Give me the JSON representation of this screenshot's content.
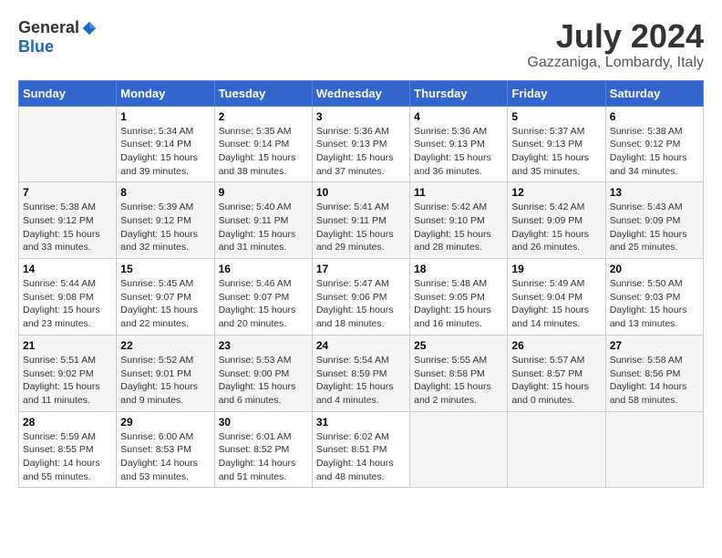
{
  "logo": {
    "general": "General",
    "blue": "Blue"
  },
  "title": "July 2024",
  "location": "Gazzaniga, Lombardy, Italy",
  "days_of_week": [
    "Sunday",
    "Monday",
    "Tuesday",
    "Wednesday",
    "Thursday",
    "Friday",
    "Saturday"
  ],
  "weeks": [
    [
      {
        "day": "",
        "info": ""
      },
      {
        "day": "1",
        "info": "Sunrise: 5:34 AM\nSunset: 9:14 PM\nDaylight: 15 hours\nand 39 minutes."
      },
      {
        "day": "2",
        "info": "Sunrise: 5:35 AM\nSunset: 9:14 PM\nDaylight: 15 hours\nand 38 minutes."
      },
      {
        "day": "3",
        "info": "Sunrise: 5:36 AM\nSunset: 9:13 PM\nDaylight: 15 hours\nand 37 minutes."
      },
      {
        "day": "4",
        "info": "Sunrise: 5:36 AM\nSunset: 9:13 PM\nDaylight: 15 hours\nand 36 minutes."
      },
      {
        "day": "5",
        "info": "Sunrise: 5:37 AM\nSunset: 9:13 PM\nDaylight: 15 hours\nand 35 minutes."
      },
      {
        "day": "6",
        "info": "Sunrise: 5:38 AM\nSunset: 9:12 PM\nDaylight: 15 hours\nand 34 minutes."
      }
    ],
    [
      {
        "day": "7",
        "info": "Sunrise: 5:38 AM\nSunset: 9:12 PM\nDaylight: 15 hours\nand 33 minutes."
      },
      {
        "day": "8",
        "info": "Sunrise: 5:39 AM\nSunset: 9:12 PM\nDaylight: 15 hours\nand 32 minutes."
      },
      {
        "day": "9",
        "info": "Sunrise: 5:40 AM\nSunset: 9:11 PM\nDaylight: 15 hours\nand 31 minutes."
      },
      {
        "day": "10",
        "info": "Sunrise: 5:41 AM\nSunset: 9:11 PM\nDaylight: 15 hours\nand 29 minutes."
      },
      {
        "day": "11",
        "info": "Sunrise: 5:42 AM\nSunset: 9:10 PM\nDaylight: 15 hours\nand 28 minutes."
      },
      {
        "day": "12",
        "info": "Sunrise: 5:42 AM\nSunset: 9:09 PM\nDaylight: 15 hours\nand 26 minutes."
      },
      {
        "day": "13",
        "info": "Sunrise: 5:43 AM\nSunset: 9:09 PM\nDaylight: 15 hours\nand 25 minutes."
      }
    ],
    [
      {
        "day": "14",
        "info": "Sunrise: 5:44 AM\nSunset: 9:08 PM\nDaylight: 15 hours\nand 23 minutes."
      },
      {
        "day": "15",
        "info": "Sunrise: 5:45 AM\nSunset: 9:07 PM\nDaylight: 15 hours\nand 22 minutes."
      },
      {
        "day": "16",
        "info": "Sunrise: 5:46 AM\nSunset: 9:07 PM\nDaylight: 15 hours\nand 20 minutes."
      },
      {
        "day": "17",
        "info": "Sunrise: 5:47 AM\nSunset: 9:06 PM\nDaylight: 15 hours\nand 18 minutes."
      },
      {
        "day": "18",
        "info": "Sunrise: 5:48 AM\nSunset: 9:05 PM\nDaylight: 15 hours\nand 16 minutes."
      },
      {
        "day": "19",
        "info": "Sunrise: 5:49 AM\nSunset: 9:04 PM\nDaylight: 15 hours\nand 14 minutes."
      },
      {
        "day": "20",
        "info": "Sunrise: 5:50 AM\nSunset: 9:03 PM\nDaylight: 15 hours\nand 13 minutes."
      }
    ],
    [
      {
        "day": "21",
        "info": "Sunrise: 5:51 AM\nSunset: 9:02 PM\nDaylight: 15 hours\nand 11 minutes."
      },
      {
        "day": "22",
        "info": "Sunrise: 5:52 AM\nSunset: 9:01 PM\nDaylight: 15 hours\nand 9 minutes."
      },
      {
        "day": "23",
        "info": "Sunrise: 5:53 AM\nSunset: 9:00 PM\nDaylight: 15 hours\nand 6 minutes."
      },
      {
        "day": "24",
        "info": "Sunrise: 5:54 AM\nSunset: 8:59 PM\nDaylight: 15 hours\nand 4 minutes."
      },
      {
        "day": "25",
        "info": "Sunrise: 5:55 AM\nSunset: 8:58 PM\nDaylight: 15 hours\nand 2 minutes."
      },
      {
        "day": "26",
        "info": "Sunrise: 5:57 AM\nSunset: 8:57 PM\nDaylight: 15 hours\nand 0 minutes."
      },
      {
        "day": "27",
        "info": "Sunrise: 5:58 AM\nSunset: 8:56 PM\nDaylight: 14 hours\nand 58 minutes."
      }
    ],
    [
      {
        "day": "28",
        "info": "Sunrise: 5:59 AM\nSunset: 8:55 PM\nDaylight: 14 hours\nand 55 minutes."
      },
      {
        "day": "29",
        "info": "Sunrise: 6:00 AM\nSunset: 8:53 PM\nDaylight: 14 hours\nand 53 minutes."
      },
      {
        "day": "30",
        "info": "Sunrise: 6:01 AM\nSunset: 8:52 PM\nDaylight: 14 hours\nand 51 minutes."
      },
      {
        "day": "31",
        "info": "Sunrise: 6:02 AM\nSunset: 8:51 PM\nDaylight: 14 hours\nand 48 minutes."
      },
      {
        "day": "",
        "info": ""
      },
      {
        "day": "",
        "info": ""
      },
      {
        "day": "",
        "info": ""
      }
    ]
  ]
}
